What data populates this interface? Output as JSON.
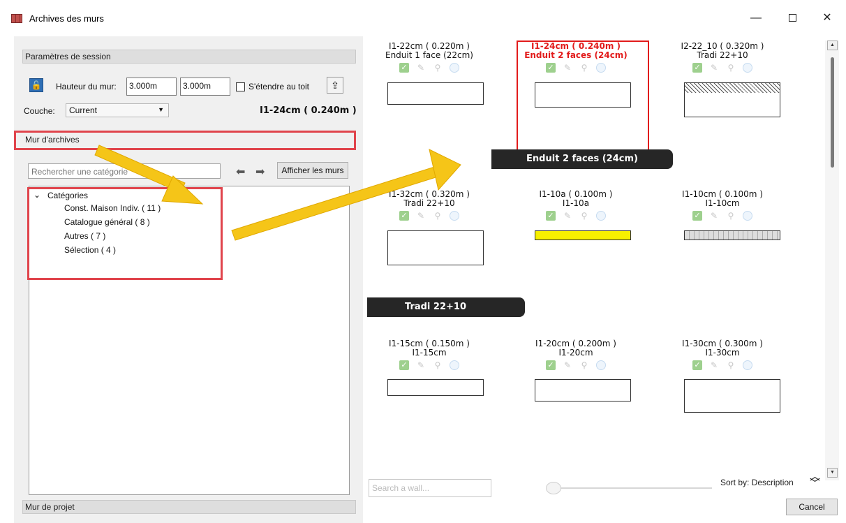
{
  "window": {
    "title": "Archives des murs",
    "min": "—",
    "close": "✕"
  },
  "session": {
    "header": "Paramètres de session",
    "height_label": "Hauteur du mur:",
    "height1": "3.000m",
    "height2": "3.000m",
    "extend_label": "S'étendre au toit",
    "layer_label": "Couche:",
    "layer_value": "Current",
    "current_wall": "I1-24cm ( 0.240m )"
  },
  "archive": {
    "header": "Mur d'archives",
    "search_placeholder": "Rechercher une catégorie",
    "show_button": "Afficher les murs",
    "tree_root": "Catégories",
    "categories": [
      "Const. Maison Indiv. ( 11 )",
      "Catalogue général ( 8 )",
      "Autres ( 7 )",
      "Sélection ( 4 )"
    ]
  },
  "project": {
    "header": "Mur de projet"
  },
  "walls": [
    {
      "l1": "I1-22cm ( 0.220m )",
      "l2": "Enduit 1 face (22cm)"
    },
    {
      "l1": "I1-24cm ( 0.240m )",
      "l2": "Enduit 2 faces (24cm)"
    },
    {
      "l1": "I2-22_10 ( 0.320m )",
      "l2": "Tradi 22+10"
    },
    {
      "l1": "I1-32cm ( 0.320m )",
      "l2": "Tradi 22+10"
    },
    {
      "l1": "I1-10a ( 0.100m )",
      "l2": "I1-10a"
    },
    {
      "l1": "I1-10cm ( 0.100m )",
      "l2": "I1-10cm"
    },
    {
      "l1": "I1-15cm ( 0.150m )",
      "l2": "I1-15cm"
    },
    {
      "l1": "I1-20cm ( 0.200m )",
      "l2": "I1-20cm"
    },
    {
      "l1": "I1-30cm ( 0.300m )",
      "l2": "I1-30cm"
    }
  ],
  "banners": {
    "b1": "Enduit 2 faces (24cm)",
    "b2": "Tradi 22+10"
  },
  "footer": {
    "search_placeholder": "Search a wall...",
    "sort_label": "Sort by: Description",
    "cancel": "Cancel"
  },
  "colors": {
    "accent_red": "#e21b1b",
    "highlight_border": "#e0444c",
    "arrow": "#f5c518",
    "banner": "#262626"
  }
}
